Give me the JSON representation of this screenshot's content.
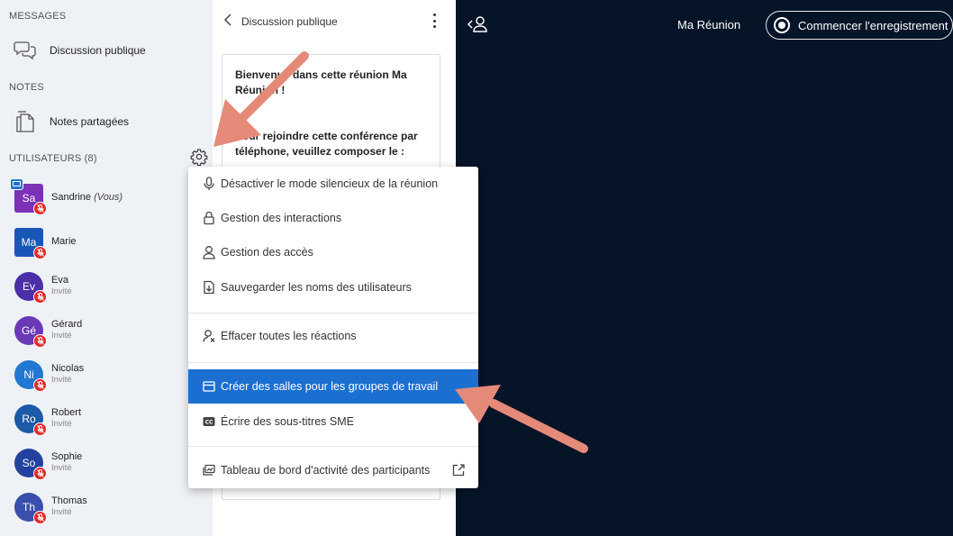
{
  "sidebar": {
    "messages_title": "MESSAGES",
    "public_chat_label": "Discussion publique",
    "notes_title": "NOTES",
    "shared_notes_label": "Notes partagées",
    "users_title": "UTILISATEURS (8)",
    "users": [
      {
        "initials": "Sa",
        "name": "Sandrine",
        "suffix": "(Vous)",
        "role": "",
        "color": "#7b32b5"
      },
      {
        "initials": "Ma",
        "name": "Marie",
        "suffix": "",
        "role": "",
        "color": "#1857b6"
      },
      {
        "initials": "Ev",
        "name": "Eva",
        "suffix": "",
        "role": "Invité",
        "color": "#4b2ea8"
      },
      {
        "initials": "Gé",
        "name": "Gérard",
        "suffix": "",
        "role": "Invité",
        "color": "#6a39b7"
      },
      {
        "initials": "Ni",
        "name": "Nicolas",
        "suffix": "",
        "role": "Invité",
        "color": "#2277d2"
      },
      {
        "initials": "Ro",
        "name": "Robert",
        "suffix": "",
        "role": "Invité",
        "color": "#1c5aa8"
      },
      {
        "initials": "So",
        "name": "Sophie",
        "suffix": "",
        "role": "Invité",
        "color": "#23429f"
      },
      {
        "initials": "Th",
        "name": "Thomas",
        "suffix": "",
        "role": "Invité",
        "color": "#3a4fab"
      }
    ]
  },
  "chat": {
    "title": "Discussion publique",
    "welcome_line1": "Bienvenue dans cette réunion Ma Réunion !",
    "welcome_line2": "Pour rejoindre cette conférence par téléphone, veuillez composer le :"
  },
  "header": {
    "meeting_name": "Ma Réunion",
    "record_label": "Commencer l'enregistrement"
  },
  "menu": {
    "items": [
      {
        "label": "Désactiver le mode silencieux de la réunion",
        "icon": "microphone-icon"
      },
      {
        "label": "Gestion des interactions",
        "icon": "lock-icon"
      },
      {
        "label": "Gestion des accès",
        "icon": "user-icon"
      },
      {
        "label": "Sauvegarder les noms des utilisateurs",
        "icon": "download-file-icon"
      },
      {
        "label": "Effacer toutes les réactions",
        "icon": "clear-reactions-icon"
      },
      {
        "label": "Créer des salles pour les groupes de travail",
        "icon": "breakout-rooms-icon"
      },
      {
        "label": "Écrire des sous-titres SME",
        "icon": "closed-captions-icon"
      },
      {
        "label": "Tableau de bord d'activité des participants",
        "icon": "dashboard-icon"
      }
    ]
  },
  "colors": {
    "main_bg": "#061428",
    "accent": "#1b6fd1",
    "arrow": "#e58a79",
    "mic_muted": "#df2a2a"
  }
}
